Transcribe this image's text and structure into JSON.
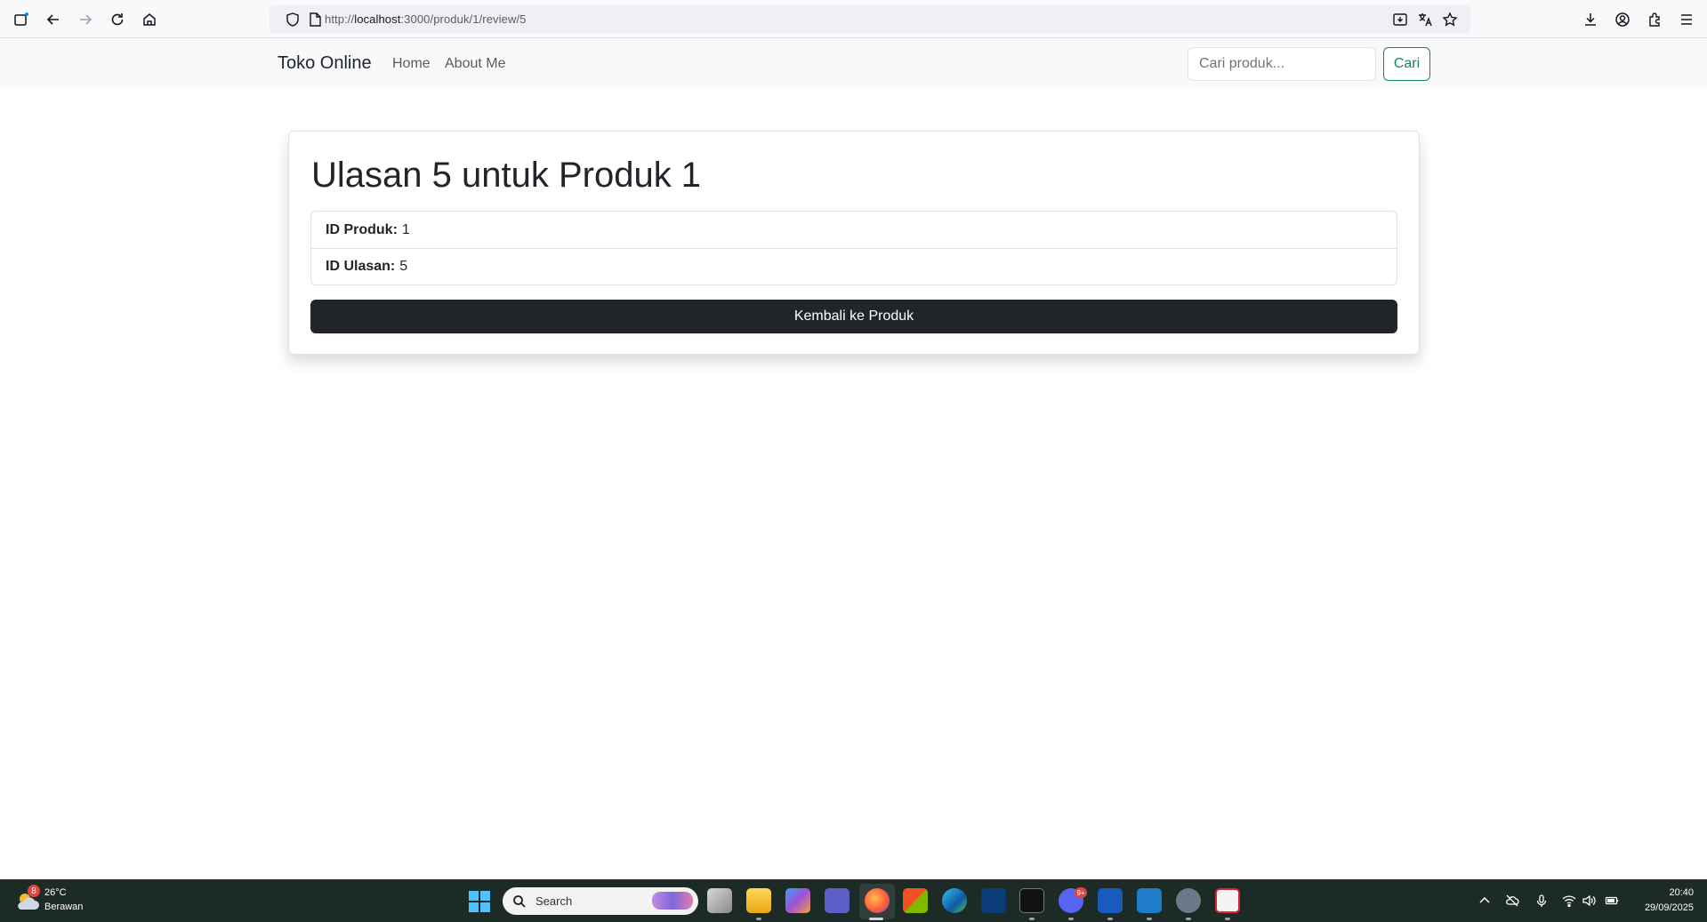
{
  "browser": {
    "url_prefix": "http://",
    "url_host": "localhost",
    "url_path": ":3000/produk/1/review/5"
  },
  "navbar": {
    "brand": "Toko Online",
    "links": [
      "Home",
      "About Me"
    ],
    "search_placeholder": "Cari produk...",
    "search_button": "Cari"
  },
  "review": {
    "title": "Ulasan 5 untuk Produk 1",
    "product_id_label": "ID Produk:",
    "product_id_value": "1",
    "review_id_label": "ID Ulasan:",
    "review_id_value": "5",
    "back_button": "Kembali ke Produk"
  },
  "taskbar": {
    "weather_temp": "26°C",
    "weather_desc": "Berawan",
    "weather_badge": "8",
    "search_label": "Search",
    "discord_badge": "9+",
    "time": "20:40",
    "date": "29/09/2025"
  },
  "colors": {
    "success": "#198754",
    "dark_button": "#212529",
    "navbar_bg": "#f8f9fa",
    "taskbar_bg": "#1c2b26"
  }
}
